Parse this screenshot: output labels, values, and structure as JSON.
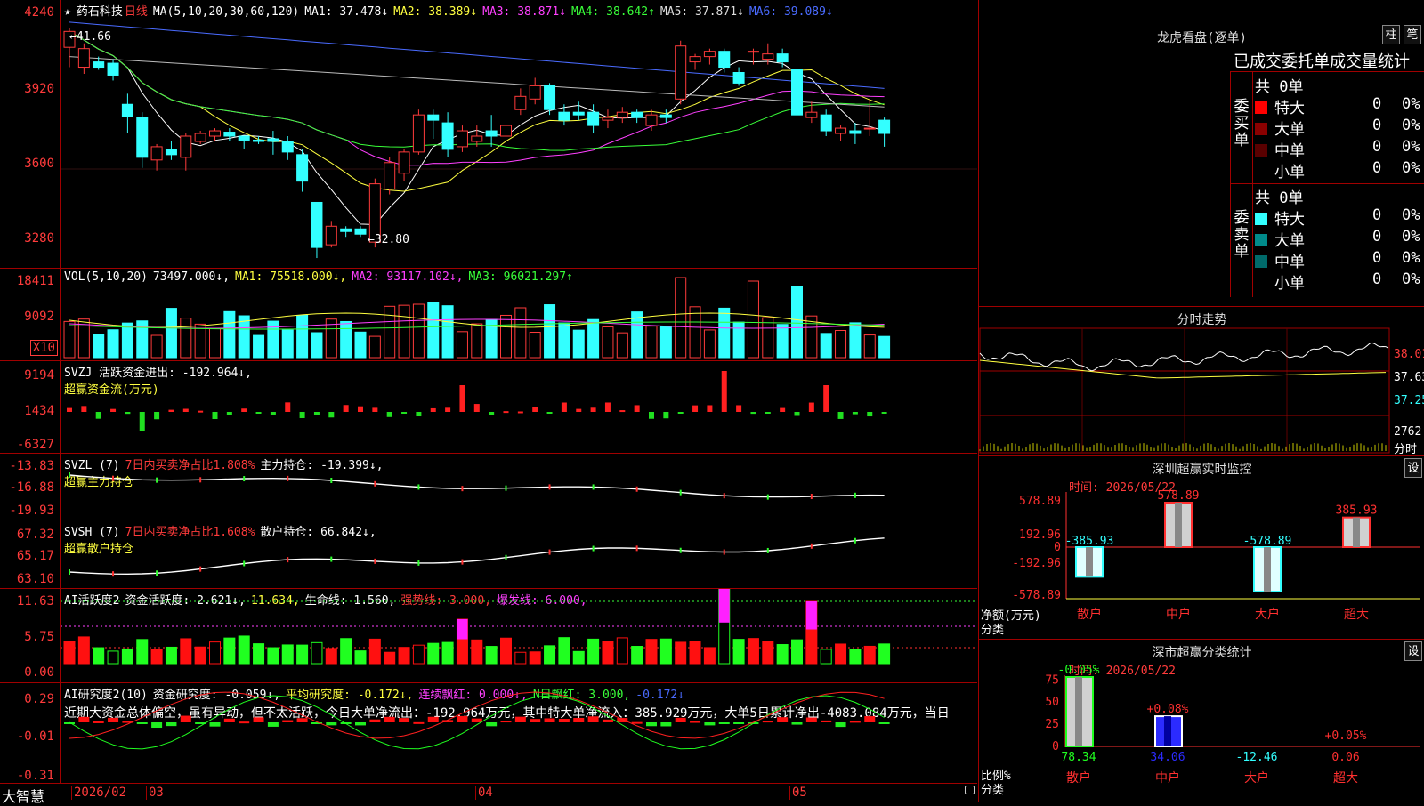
{
  "title": {
    "name": "药石科技",
    "period": "日线",
    "ma_label": "MA(5,10,20,30,60,120)",
    "ma_values": [
      {
        "label": "MA1: 37.478↓",
        "color": "#ffffff"
      },
      {
        "label": "MA2: 38.389↓",
        "color": "#ffff40"
      },
      {
        "label": "MA3: 38.871↓",
        "color": "#ff40ff"
      },
      {
        "label": "MA4: 38.642↑",
        "color": "#39ff39"
      },
      {
        "label": "MA5: 37.871↓",
        "color": "#dddddd"
      },
      {
        "label": "MA6: 39.089↓",
        "color": "#4a6bff"
      }
    ]
  },
  "price_axis": [
    "4240",
    "3920",
    "3600",
    "3280"
  ],
  "price_annotations": {
    "high": "41.66",
    "low": "32.80"
  },
  "vol": {
    "header": "VOL(5,10,20)",
    "value": "73497.000↓,",
    "mas": [
      {
        "label": "MA1: 75518.000↓,",
        "color": "#ffff40"
      },
      {
        "label": "MA2: 93117.102↓,",
        "color": "#ff40ff"
      },
      {
        "label": "MA3: 96021.297↑",
        "color": "#39ff39"
      }
    ],
    "axis": [
      "18411",
      "9092"
    ],
    "unit": "X10"
  },
  "svzj": {
    "line1": "SVZJ  活跃资金进出: -192.964↓,",
    "line2": "超赢资金流(万元)",
    "axis": [
      "9194",
      "1434",
      "-6327"
    ]
  },
  "svzl": {
    "name": "SVZL (7)",
    "ratio": "7日内买卖净占比1.808%",
    "hold": "主力持仓: -19.399↓,",
    "line2": "超赢主力持仓",
    "axis": [
      "-13.83",
      "-16.88",
      "-19.93"
    ]
  },
  "svsh": {
    "name": "SVSH (7)",
    "ratio": "7日内买卖净占比1.608%",
    "hold": "散户持仓: 66.842↓,",
    "line2": "超赢散户持仓",
    "axis": [
      "67.32",
      "65.17",
      "63.10"
    ]
  },
  "ai1": {
    "name": "AI活跃度2",
    "v1": "资金活跃度: 2.621↓,",
    "v2": "11.634,",
    "v3": "生命线: 1.560,",
    "v4": "强势线: 3.000,",
    "v5": "爆发线: 6.000,",
    "axis": [
      "11.63",
      "5.75",
      "0.00"
    ]
  },
  "ai2": {
    "name": "AI研究度2(10)",
    "v1": "资金研究度: -0.059↓,",
    "v2": "平均研究度: -0.172↓,",
    "v3": "连续飘红: 0.000↓,",
    "v4": "N日飘红: 3.000,",
    "v5": "-0.172↓",
    "comment": "近期大资金总体偏空，虽有异动，但不太活跃，今日大单净流出：-192.964万元，其中特大单净流入：385.929万元，大单5日累计净出-4083.084万元，当日",
    "axis": [
      "0.29",
      "-0.01",
      "-0.31"
    ]
  },
  "bottom_axis": {
    "brand": "大智慧",
    "labels": [
      "2026/02",
      "03",
      "04",
      "05"
    ]
  },
  "lhb": {
    "title": "龙虎看盘(逐单)",
    "btn_zhu": "柱",
    "btn_bi": "笔",
    "subtitle": "已成交委托单成交量统计",
    "buy_label": "委买单",
    "sell_label": "委卖单",
    "buy_total": "共 0单",
    "sell_total": "共 0单",
    "buy_rows": [
      {
        "label": "特大",
        "value": "0",
        "pct": "0%",
        "color": "#ff0000"
      },
      {
        "label": "大单",
        "value": "0",
        "pct": "0%",
        "color": "#8a0000"
      },
      {
        "label": "中单",
        "value": "0",
        "pct": "0%",
        "color": "#5a0000"
      },
      {
        "label": "小单",
        "value": "0",
        "pct": "0%",
        "color": "#000000"
      }
    ],
    "sell_rows": [
      {
        "label": "特大",
        "value": "0",
        "pct": "0%",
        "color": "#33ffff"
      },
      {
        "label": "大单",
        "value": "0",
        "pct": "0%",
        "color": "#008a8a"
      },
      {
        "label": "中单",
        "value": "0",
        "pct": "0%",
        "color": "#006a6a"
      },
      {
        "label": "小单",
        "value": "0",
        "pct": "0%",
        "color": "#000000"
      }
    ]
  },
  "fenshi": {
    "title": "分时走势",
    "axis": [
      "38.01",
      "37.63",
      "37.25",
      "2762"
    ],
    "tag": "分时"
  },
  "monitor": {
    "title": "深圳超赢实时监控",
    "btn": "设",
    "time": "时间: 2026/05/22",
    "axis": [
      "578.89",
      "192.96",
      "0",
      "-192.96",
      "-578.89"
    ],
    "ylabel1": "净额(万元)",
    "ylabel2": "分类",
    "categories": [
      "散户",
      "中户",
      "大户",
      "超大"
    ],
    "values": [
      -385.93,
      578.89,
      -578.89,
      385.93
    ],
    "value_labels": [
      "-385.93",
      "578.89",
      "-578.89",
      "385.93"
    ]
  },
  "classify": {
    "title": "深市超赢分类统计",
    "btn": "设",
    "time": "时间: 2026/05/22",
    "axis": [
      "75",
      "50",
      "25",
      "0"
    ],
    "ylabel1": "比例%",
    "ylabel2": "分类",
    "categories": [
      "散户",
      "中户",
      "大户",
      "超大"
    ],
    "top_labels": [
      "-0.05%",
      "+0.08%",
      "",
      "+0.05%"
    ],
    "values": [
      78.34,
      34.06,
      -12.46,
      0.06
    ],
    "value_labels": [
      "78.34",
      "34.06",
      "-12.46",
      "0.06"
    ]
  },
  "chart_data": {
    "type": "candlestick",
    "candles": [
      [
        40.95,
        41.55,
        40.2,
        41.66
      ],
      [
        40.2,
        40.9,
        39.95,
        41.1
      ],
      [
        40.4,
        40.2,
        40.1,
        40.6
      ],
      [
        40.35,
        39.9,
        39.7,
        40.5
      ],
      [
        38.8,
        38.35,
        37.7,
        39.2
      ],
      [
        38.3,
        36.8,
        36.4,
        38.5
      ],
      [
        36.7,
        37.2,
        36.3,
        37.3
      ],
      [
        37.1,
        36.9,
        36.7,
        37.4
      ],
      [
        36.8,
        37.6,
        36.3,
        37.7
      ],
      [
        37.4,
        37.7,
        37.3,
        37.8
      ],
      [
        37.6,
        37.8,
        37.4,
        37.9
      ],
      [
        37.75,
        37.6,
        37.4,
        37.9
      ],
      [
        37.6,
        37.45,
        37.1,
        37.6
      ],
      [
        37.45,
        37.4,
        37.3,
        37.6
      ],
      [
        37.5,
        37.4,
        36.9,
        37.8
      ],
      [
        37.4,
        37.0,
        36.7,
        37.6
      ],
      [
        36.9,
        35.9,
        35.5,
        37.1
      ],
      [
        35.1,
        33.4,
        33.0,
        35.1
      ],
      [
        33.5,
        34.2,
        33.4,
        34.4
      ],
      [
        34.1,
        34.0,
        33.8,
        34.2
      ],
      [
        34.1,
        33.9,
        33.8,
        34.2
      ],
      [
        33.6,
        35.8,
        33.4,
        36.0
      ],
      [
        35.6,
        36.6,
        35.4,
        36.8
      ],
      [
        36.2,
        37.0,
        35.9,
        37.1
      ],
      [
        37.0,
        38.4,
        36.9,
        38.6
      ],
      [
        38.4,
        38.2,
        37.5,
        38.6
      ],
      [
        38.1,
        37.1,
        36.8,
        38.5
      ],
      [
        37.2,
        37.8,
        37.0,
        38.0
      ],
      [
        37.4,
        37.6,
        37.2,
        38.0
      ],
      [
        37.8,
        37.6,
        37.2,
        38.4
      ],
      [
        37.6,
        38.0,
        37.4,
        38.2
      ],
      [
        38.6,
        39.1,
        38.4,
        39.4
      ],
      [
        39.0,
        39.5,
        38.8,
        39.8
      ],
      [
        39.5,
        38.6,
        38.4,
        39.6
      ],
      [
        38.5,
        38.2,
        38.0,
        38.8
      ],
      [
        38.5,
        38.4,
        38.2,
        38.9
      ],
      [
        38.5,
        38.0,
        37.7,
        38.8
      ],
      [
        38.2,
        38.3,
        37.9,
        38.6
      ],
      [
        38.3,
        38.5,
        38.1,
        38.7
      ],
      [
        38.5,
        38.3,
        38.1,
        38.6
      ],
      [
        38.0,
        38.4,
        37.8,
        38.6
      ],
      [
        38.4,
        38.3,
        38.1,
        38.6
      ],
      [
        39.0,
        41.0,
        38.8,
        41.2
      ],
      [
        40.4,
        40.6,
        40.1,
        40.7
      ],
      [
        40.6,
        40.8,
        40.3,
        40.9
      ],
      [
        40.8,
        40.2,
        40.0,
        40.9
      ],
      [
        40.0,
        39.6,
        39.5,
        40.2
      ],
      [
        40.8,
        40.8,
        40.3,
        40.9
      ],
      [
        40.5,
        40.7,
        40.3,
        41.1
      ],
      [
        40.7,
        40.4,
        40.2,
        40.9
      ],
      [
        40.1,
        38.4,
        38.0,
        40.3
      ],
      [
        38.3,
        38.5,
        38.1,
        38.9
      ],
      [
        38.4,
        37.8,
        37.6,
        38.6
      ],
      [
        37.7,
        37.9,
        37.4,
        38.0
      ],
      [
        37.8,
        37.7,
        37.3,
        38.1
      ],
      [
        37.9,
        37.9,
        37.6,
        39.0
      ],
      [
        38.2,
        37.7,
        37.2,
        38.3
      ]
    ],
    "ylim": [
      32.8,
      42.4
    ],
    "x_labels": [
      "2026/02",
      "03",
      "04",
      "05"
    ]
  }
}
